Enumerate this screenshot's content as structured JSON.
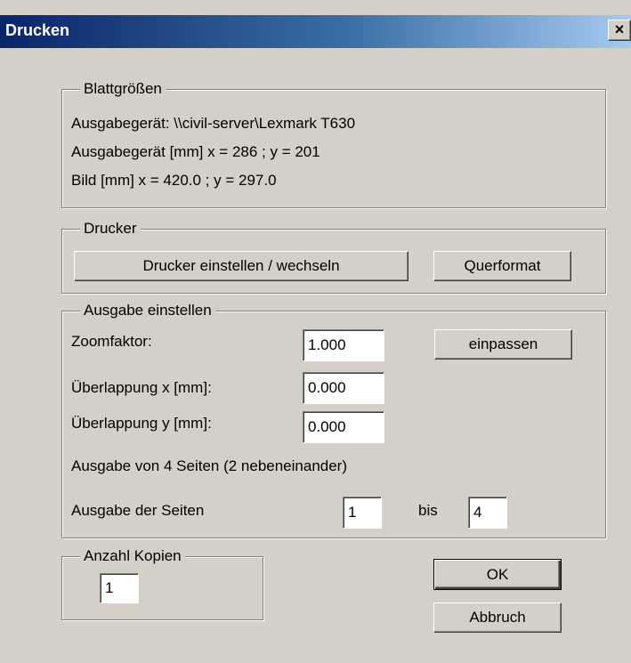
{
  "window": {
    "title": "Drucken",
    "close_glyph": "×"
  },
  "sheet_sizes": {
    "legend": "Blattgrößen",
    "device": "Ausgabegerät: \\\\civil-server\\Lexmark T630",
    "device_mm": "Ausgabegerät [mm]   x = 286 ; y = 201",
    "image_mm": "Bild [mm]   x = 420.0 ; y = 297.0"
  },
  "printer": {
    "legend": "Drucker",
    "setup_button": "Drucker einstellen / wechseln",
    "landscape_button": "Querformat"
  },
  "output": {
    "legend": "Ausgabe einstellen",
    "zoom_label": "Zoomfaktor:",
    "zoom_value": "1.000",
    "fit_button": "einpassen",
    "overlap_x_label": "Überlappung x [mm]:",
    "overlap_x_value": "0.000",
    "overlap_y_label": "Überlappung y [mm]:",
    "overlap_y_value": "0.000",
    "pages_info": "Ausgabe von 4 Seiten (2 nebeneinander)",
    "pages_label": "Ausgabe der Seiten",
    "page_from": "1",
    "page_to_label": "bis",
    "page_to": "4"
  },
  "copies": {
    "legend": "Anzahl Kopien",
    "value": "1"
  },
  "buttons": {
    "ok": "OK",
    "cancel": "Abbruch"
  }
}
